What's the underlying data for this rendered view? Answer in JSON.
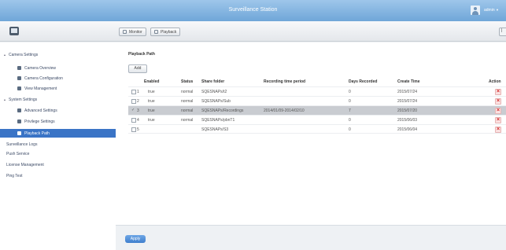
{
  "window": {
    "title": "Surveillance Station",
    "user": "admin"
  },
  "toolbar": {
    "monitor_label": "Monitor",
    "playback_label": "Playback"
  },
  "sidebar": {
    "items": [
      {
        "label": "Camera Settings",
        "level": 0,
        "expander": "▴"
      },
      {
        "label": "Camera Overview",
        "level": 1
      },
      {
        "label": "Camera Configuration",
        "level": 1
      },
      {
        "label": "View Management",
        "level": 1
      },
      {
        "label": "System Settings",
        "level": 0,
        "expander": "▴"
      },
      {
        "label": "Advanced Settings",
        "level": 1
      },
      {
        "label": "Privilege Settings",
        "level": 1
      },
      {
        "label": "Playback Path",
        "level": 1,
        "selected": true
      },
      {
        "label": "Surveillance Logs",
        "level": 0
      },
      {
        "label": "Push Service",
        "level": 0
      },
      {
        "label": "License Management",
        "level": 0
      },
      {
        "label": "Ping Test",
        "level": 0
      }
    ]
  },
  "main": {
    "section_title": "Playback Path",
    "add_label": "Add",
    "columns": [
      "Enabled",
      "Status",
      "Share folder",
      "Recording time period",
      "Days Recorded",
      "Create Time",
      "Action"
    ],
    "rows": [
      {
        "index": "1",
        "enabled": "true",
        "status": "normal",
        "folder": "SQESNAPs/t2",
        "period": "",
        "days": "0",
        "created": "2015/07/24"
      },
      {
        "index": "2",
        "enabled": "true",
        "status": "normal",
        "folder": "SQESNAPs/Sub",
        "period": "",
        "days": "0",
        "created": "2015/07/24"
      },
      {
        "index": "3",
        "enabled": "true",
        "status": "normal",
        "folder": "SQESNAPs/Recordings",
        "period": "2014/01/09-2014/02/10",
        "days": "7",
        "created": "2015/07/20",
        "selected": true
      },
      {
        "index": "4",
        "enabled": "true",
        "status": "normal",
        "folder": "SQESNAPs/pbnT1",
        "period": "",
        "days": "0",
        "created": "2015/06/03"
      },
      {
        "index": "5",
        "enabled": "",
        "status": "",
        "folder": "SQESNAPs/S3",
        "period": "",
        "days": "0",
        "created": "2015/06/04"
      }
    ],
    "apply_label": "Apply"
  },
  "colors": {
    "titlebar": "#7fb2e0",
    "selected": "#3a74c6",
    "delete": "#d42c2c"
  }
}
